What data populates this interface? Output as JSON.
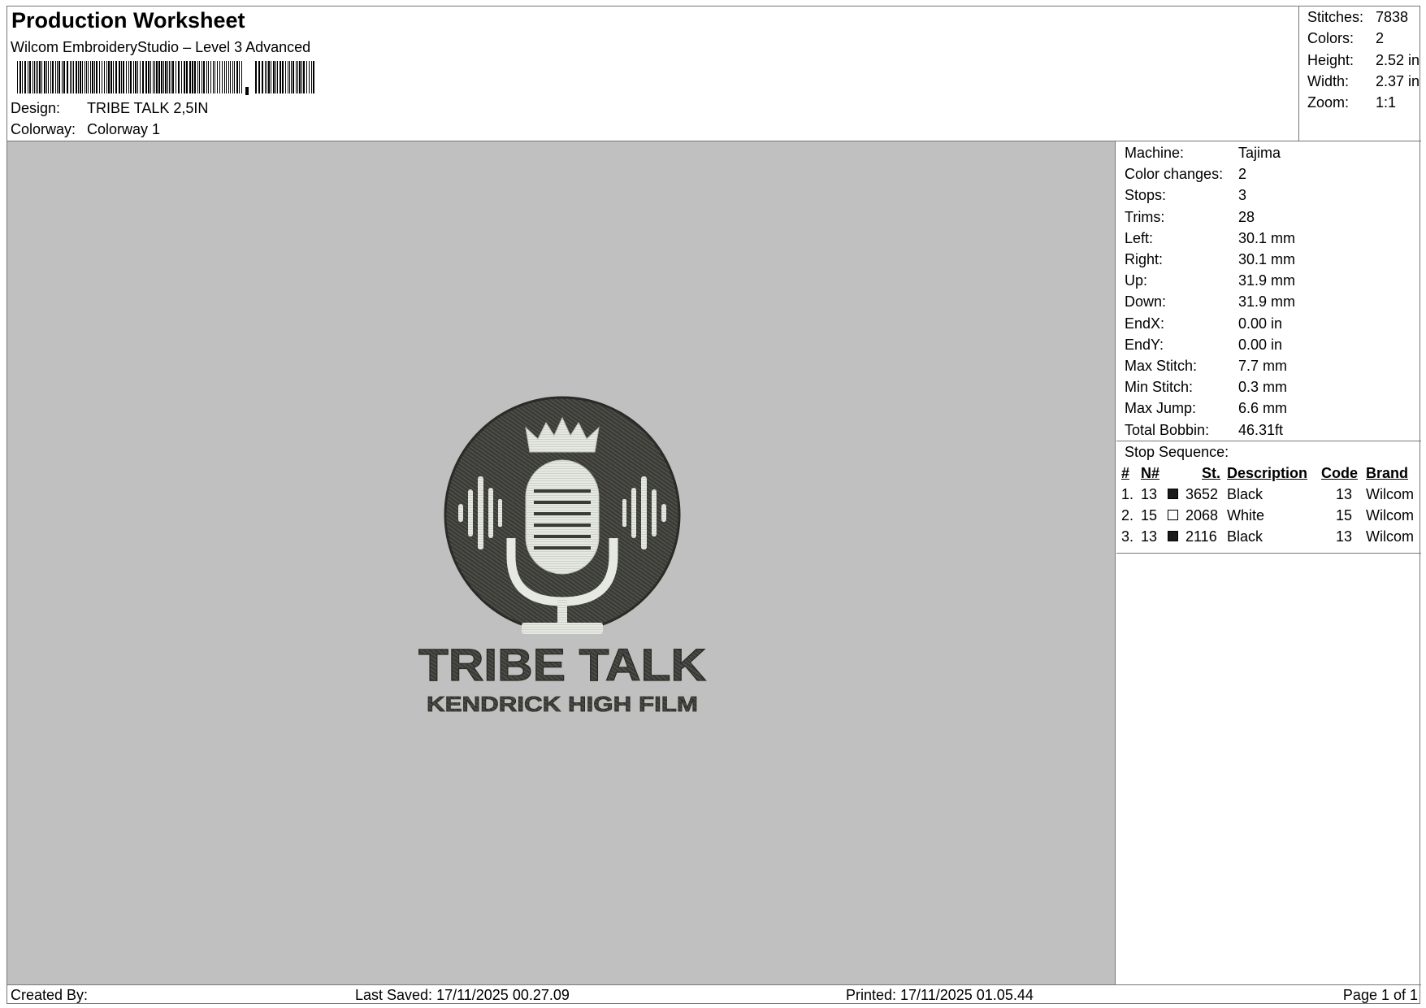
{
  "header": {
    "title": "Production Worksheet",
    "subtitle": "Wilcom EmbroideryStudio – Level 3 Advanced",
    "design_label": "Design:",
    "design_value": "TRIBE TALK 2,5IN",
    "colorway_label": "Colorway:",
    "colorway_value": "Colorway 1"
  },
  "summary": {
    "stitches_label": "Stitches:",
    "stitches_value": "7838",
    "colors_label": "Colors:",
    "colors_value": "2",
    "height_label": "Height:",
    "height_value": "2.52 in",
    "width_label": "Width:",
    "width_value": "2.37 in",
    "zoom_label": "Zoom:",
    "zoom_value": "1:1"
  },
  "properties": [
    {
      "label": "Machine:",
      "value": "Tajima"
    },
    {
      "label": "Color changes:",
      "value": "2"
    },
    {
      "label": "Stops:",
      "value": "3"
    },
    {
      "label": "Trims:",
      "value": "28"
    },
    {
      "label": "Left:",
      "value": "30.1 mm"
    },
    {
      "label": "Right:",
      "value": "30.1 mm"
    },
    {
      "label": "Up:",
      "value": "31.9 mm"
    },
    {
      "label": "Down:",
      "value": "31.9 mm"
    },
    {
      "label": "EndX:",
      "value": "0.00 in"
    },
    {
      "label": "EndY:",
      "value": "0.00 in"
    },
    {
      "label": "Max Stitch:",
      "value": "7.7 mm"
    },
    {
      "label": "Min Stitch:",
      "value": "0.3 mm"
    },
    {
      "label": "Max Jump:",
      "value": "6.6 mm"
    },
    {
      "label": "Total Bobbin:",
      "value": "46.31ft"
    }
  ],
  "stop_sequence": {
    "label": "Stop Sequence:",
    "headers": {
      "num": "#",
      "needle": "N#",
      "stitches": "St.",
      "description": "Description",
      "code": "Code",
      "brand": "Brand"
    },
    "rows": [
      {
        "num": "1.",
        "needle": "13",
        "swatch": "#1a1a1a",
        "stitches": "3652",
        "description": "Black",
        "code": "13",
        "brand": "Wilcom"
      },
      {
        "num": "2.",
        "needle": "15",
        "swatch": "#ffffff",
        "stitches": "2068",
        "description": "White",
        "code": "15",
        "brand": "Wilcom"
      },
      {
        "num": "3.",
        "needle": "13",
        "swatch": "#1a1a1a",
        "stitches": "2116",
        "description": "Black",
        "code": "13",
        "brand": "Wilcom"
      }
    ]
  },
  "design_preview": {
    "title_text": "TRIBE TALK",
    "subtitle_text": "KENDRICK HIGH FILM",
    "thread_dark": "#3a3a36",
    "thread_light": "#e6e8e2",
    "background": "#c0c0c0"
  },
  "footer": {
    "created_by": "Created By:",
    "last_saved": "Last Saved: 17/11/2025 00.27.09",
    "printed": "Printed: 17/11/2025 01.05.44",
    "page": "Page 1 of 1"
  }
}
